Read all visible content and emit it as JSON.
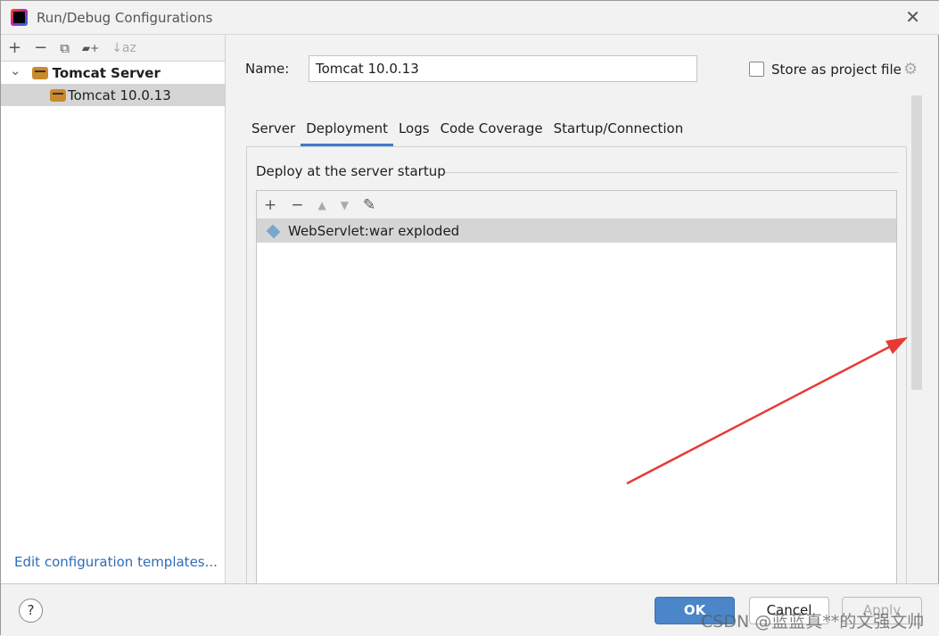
{
  "window": {
    "title": "Run/Debug Configurations",
    "close": "✕"
  },
  "sidebar": {
    "toolbar": [
      "+",
      "−",
      "⧉",
      "▰+",
      "↓az"
    ],
    "tree": [
      {
        "label": "Tomcat Server",
        "chevron": "⌄"
      },
      {
        "label": "Tomcat 10.0.13"
      }
    ],
    "edit_templates": "Edit configuration templates..."
  },
  "form": {
    "name_label": "Name:",
    "name_value": "Tomcat 10.0.13",
    "store_label": "Store as project file",
    "gear": "⚙"
  },
  "tabs": [
    {
      "label": "Server"
    },
    {
      "label": "Deployment",
      "active": true
    },
    {
      "label": "Logs"
    },
    {
      "label": "Code Coverage"
    },
    {
      "label": "Startup/Connection"
    }
  ],
  "deployment": {
    "section": "Deploy at the server startup",
    "toolbar": [
      "+",
      "−",
      "▲",
      "▼",
      "✎"
    ],
    "items": [
      "WebServlet:war exploded"
    ]
  },
  "footer": {
    "help": "?",
    "ok": "OK",
    "cancel": "Cancel",
    "apply": "Apply"
  },
  "watermark": "CSDN @蓝蓝真**的文强文帅",
  "annotation_color": "#e83a35"
}
